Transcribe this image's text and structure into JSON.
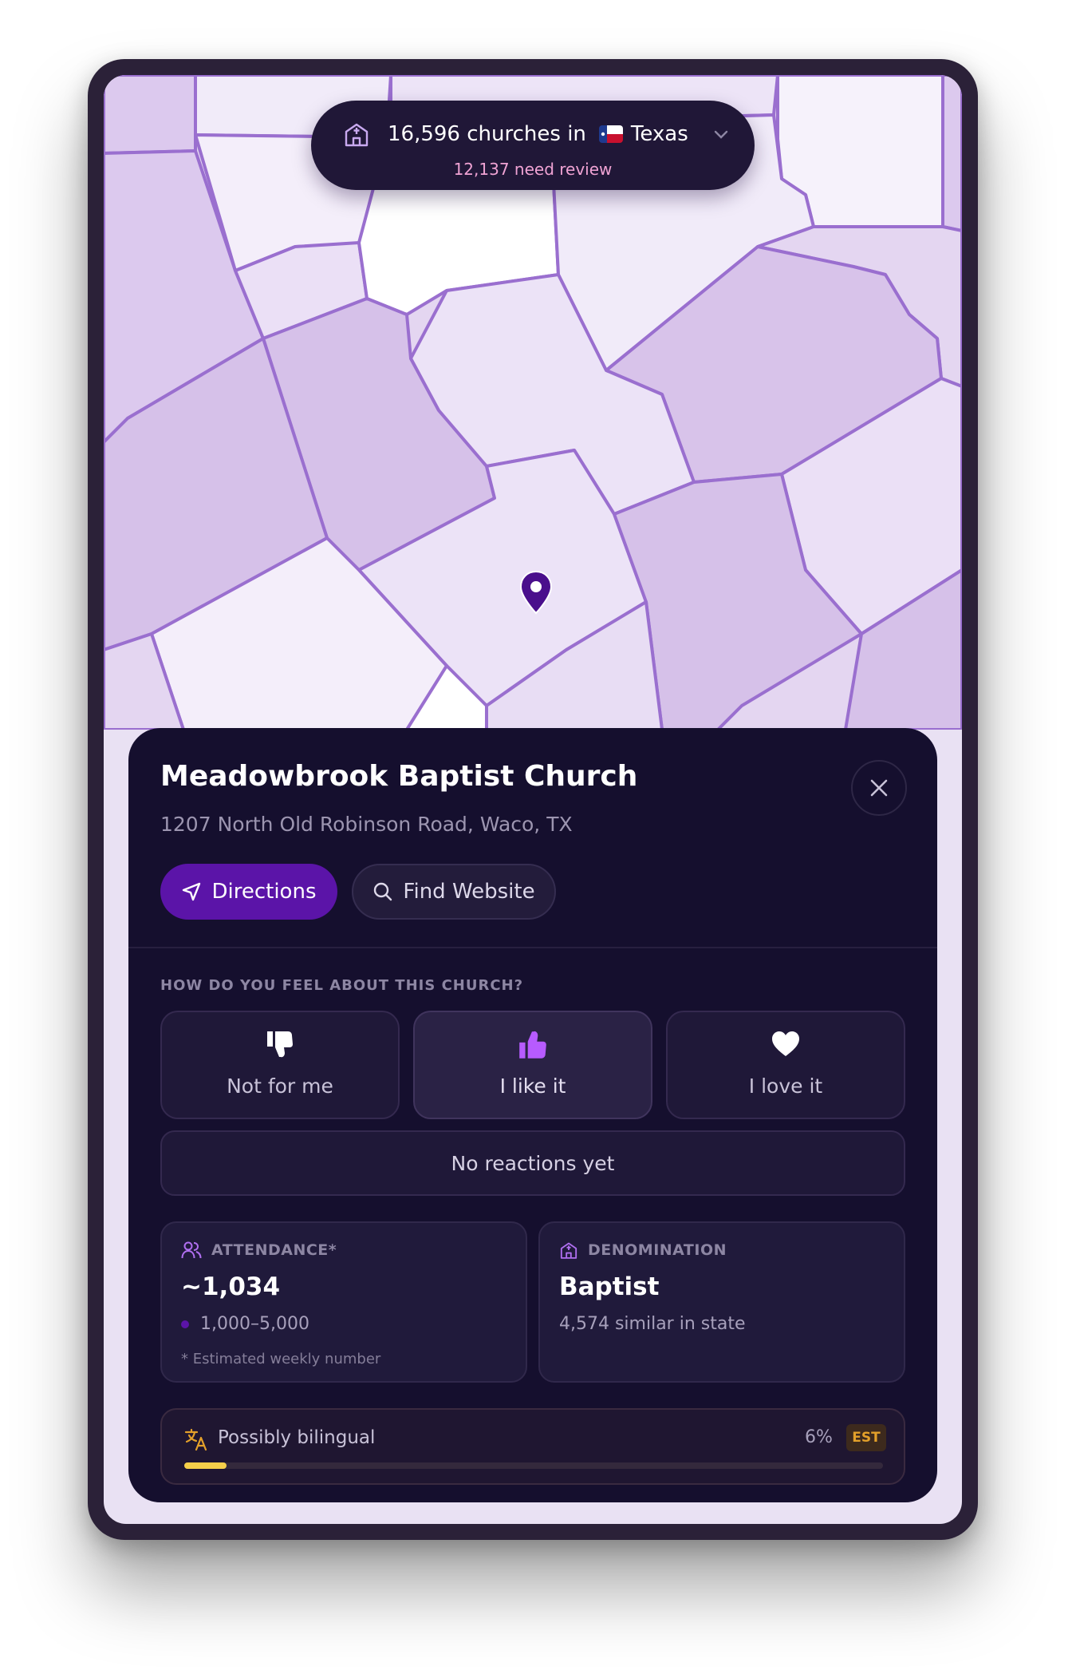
{
  "map": {
    "header": {
      "church_count": "16,596 churches in",
      "state": "Texas",
      "review_count": "12,137 need review"
    }
  },
  "church": {
    "name": "Meadowbrook Baptist Church",
    "address": "1207 North Old Robinson Road, Waco, TX",
    "actions": {
      "directions": "Directions",
      "find_website": "Find Website"
    }
  },
  "feedback": {
    "question": "HOW DO YOU FEEL ABOUT THIS CHURCH?",
    "options": [
      {
        "label": "Not for me",
        "icon": "thumbs-down-icon"
      },
      {
        "label": "I like it",
        "icon": "thumbs-up-icon",
        "selected": true
      },
      {
        "label": "I love it",
        "icon": "heart-icon"
      }
    ],
    "status": "No reactions yet"
  },
  "attendance": {
    "header": "ATTENDANCE*",
    "value": "~1,034",
    "range": "1,000–5,000",
    "note": "* Estimated weekly number"
  },
  "denomination": {
    "header": "DENOMINATION",
    "value": "Baptist",
    "similar": "4,574 similar in state"
  },
  "bilingual": {
    "label": "Possibly bilingual",
    "percent_label": "6%",
    "percent": 6,
    "badge": "EST"
  },
  "colors": {
    "accent": "#5b14a8",
    "sheet": "#150f2e",
    "review_pink": "#f0a3d4",
    "bar_yellow": "#f6cf4a"
  }
}
